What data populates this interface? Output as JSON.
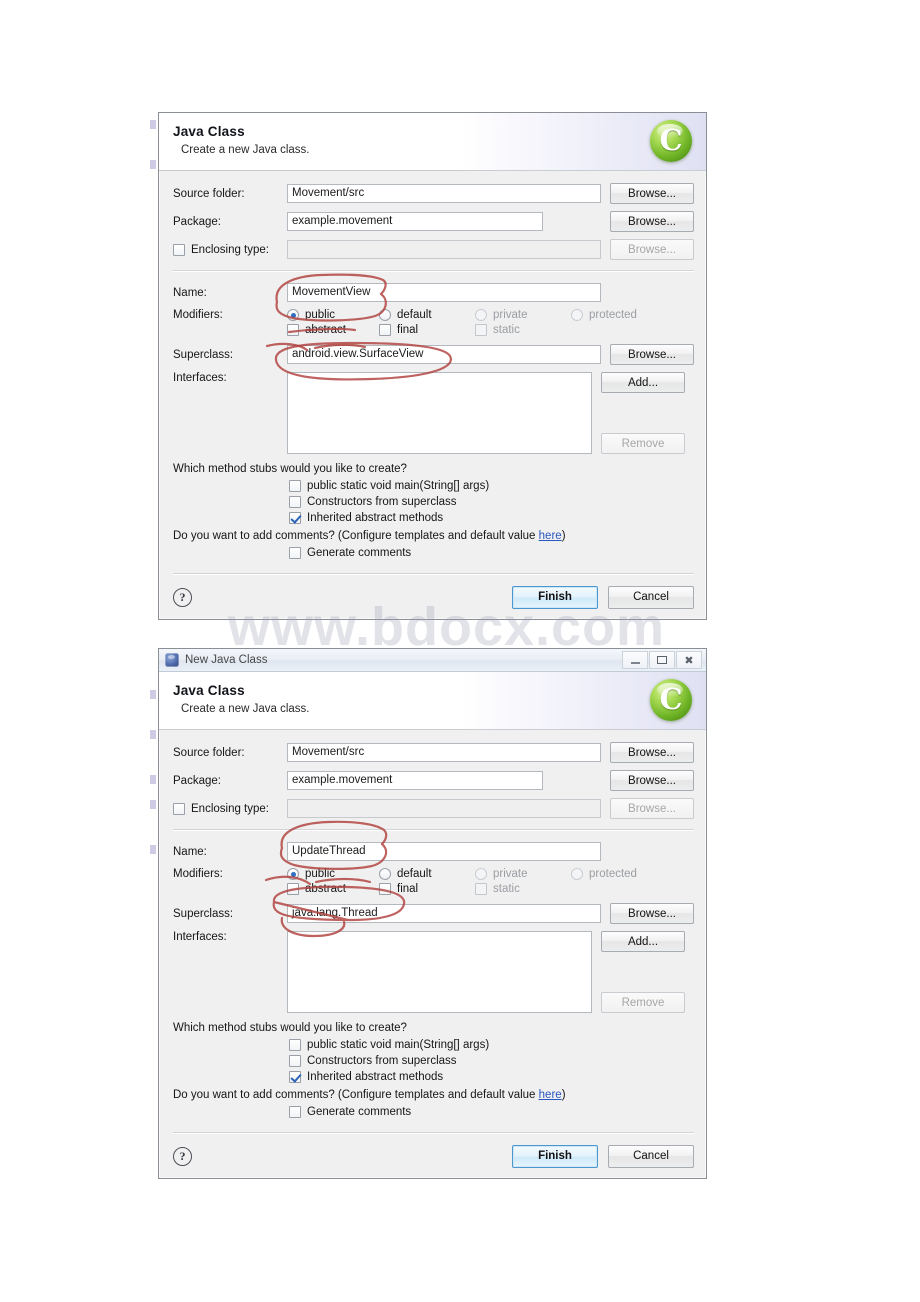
{
  "watermark": {
    "text": "www.bdocx.com"
  },
  "dialogs": [
    {
      "id": "dialog-1",
      "has_titlebar": false,
      "titlebar": {
        "title": "New Java Class",
        "icon": "java-class-icon",
        "minimize": "minimize-icon",
        "maximize": "maximize-icon",
        "close": "close-icon"
      },
      "header": {
        "title": "Java Class",
        "subtitle": "Create a new Java class.",
        "logo": "eclipse-c-orb-icon",
        "logo_glyph": "C"
      },
      "fields": {
        "source_folder_label": "Source folder:",
        "source_folder_value": "Movement/src",
        "package_label": "Package:",
        "package_value": "example.movement",
        "enclosing_type_label": "Enclosing type:",
        "enclosing_type_value": "",
        "enclosing_type_checked": false,
        "name_label": "Name:",
        "name_value": "MovementView",
        "modifiers_label": "Modifiers:",
        "superclass_label": "Superclass:",
        "superclass_value": "android.view.SurfaceView",
        "interfaces_label": "Interfaces:"
      },
      "modifiers": {
        "radios": [
          {
            "label": "public",
            "checked": true,
            "enabled": true
          },
          {
            "label": "default",
            "checked": false,
            "enabled": true
          },
          {
            "label": "private",
            "checked": false,
            "enabled": false
          },
          {
            "label": "protected",
            "checked": false,
            "enabled": false
          }
        ],
        "checkboxes": [
          {
            "label": "abstract",
            "checked": false,
            "enabled": true
          },
          {
            "label": "final",
            "checked": false,
            "enabled": true
          },
          {
            "label": "static",
            "checked": false,
            "enabled": false
          }
        ]
      },
      "buttons": {
        "browse_source": "Browse...",
        "browse_package": "Browse...",
        "browse_enclosing": "Browse...",
        "browse_superclass": "Browse...",
        "add": "Add...",
        "remove": "Remove"
      },
      "stubs": {
        "question": "Which method stubs would you like to create?",
        "items": [
          {
            "label": "public static void main(String[] args)",
            "checked": false
          },
          {
            "label": "Constructors from superclass",
            "checked": false
          },
          {
            "label": "Inherited abstract methods",
            "checked": true
          }
        ]
      },
      "comments": {
        "question_prefix": "Do you want to add comments? (Configure templates and default value ",
        "link": "here",
        "question_suffix": ")",
        "checkbox_label": "Generate comments",
        "checkbox_checked": false
      },
      "footer": {
        "help": "?",
        "finish": "Finish",
        "cancel": "Cancel"
      }
    },
    {
      "id": "dialog-2",
      "has_titlebar": true,
      "titlebar": {
        "title": "New Java Class",
        "icon": "java-class-icon",
        "minimize": "minimize-icon",
        "maximize": "maximize-icon",
        "close": "close-icon"
      },
      "header": {
        "title": "Java Class",
        "subtitle": "Create a new Java class.",
        "logo": "eclipse-c-orb-icon",
        "logo_glyph": "C"
      },
      "fields": {
        "source_folder_label": "Source folder:",
        "source_folder_value": "Movement/src",
        "package_label": "Package:",
        "package_value": "example.movement",
        "enclosing_type_label": "Enclosing type:",
        "enclosing_type_value": "",
        "enclosing_type_checked": false,
        "name_label": "Name:",
        "name_value": "UpdateThread",
        "modifiers_label": "Modifiers:",
        "superclass_label": "Superclass:",
        "superclass_value": "java.lang.Thread",
        "interfaces_label": "Interfaces:"
      },
      "modifiers": {
        "radios": [
          {
            "label": "public",
            "checked": true,
            "enabled": true
          },
          {
            "label": "default",
            "checked": false,
            "enabled": true
          },
          {
            "label": "private",
            "checked": false,
            "enabled": false
          },
          {
            "label": "protected",
            "checked": false,
            "enabled": false
          }
        ],
        "checkboxes": [
          {
            "label": "abstract",
            "checked": false,
            "enabled": true
          },
          {
            "label": "final",
            "checked": false,
            "enabled": true
          },
          {
            "label": "static",
            "checked": false,
            "enabled": false
          }
        ]
      },
      "buttons": {
        "browse_source": "Browse...",
        "browse_package": "Browse...",
        "browse_enclosing": "Browse...",
        "browse_superclass": "Browse...",
        "add": "Add...",
        "remove": "Remove"
      },
      "stubs": {
        "question": "Which method stubs would you like to create?",
        "items": [
          {
            "label": "public static void main(String[] args)",
            "checked": false
          },
          {
            "label": "Constructors from superclass",
            "checked": false
          },
          {
            "label": "Inherited abstract methods",
            "checked": true
          }
        ]
      },
      "comments": {
        "question_prefix": "Do you want to add comments? (Configure templates and default value ",
        "link": "here",
        "question_suffix": ")",
        "checkbox_label": "Generate comments",
        "checkbox_checked": false
      },
      "footer": {
        "help": "?",
        "finish": "Finish",
        "cancel": "Cancel"
      }
    }
  ],
  "annotations": {
    "color": "#b0413e",
    "marks": [
      "circle-around-name-movementview",
      "circle-around-superclass-surfaceview",
      "strike-through-public-modifier",
      "underline-final-checkbox",
      "circle-around-name-updatethread",
      "circle-around-superclass-javalangthread",
      "strike-through-abstract-final"
    ]
  }
}
